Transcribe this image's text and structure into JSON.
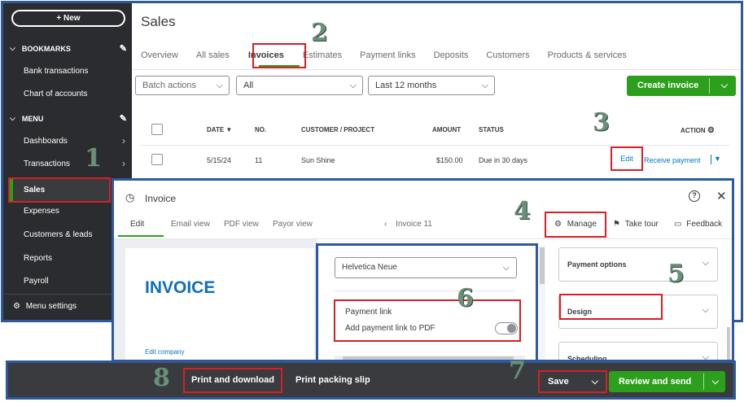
{
  "sidebar": {
    "new_label": "+ New",
    "bookmarks_label": "BOOKMARKS",
    "bookmarks": [
      "Bank transactions",
      "Chart of accounts"
    ],
    "menu_label": "MENU",
    "items": [
      {
        "label": "Dashboards",
        "arrow": true
      },
      {
        "label": "Transactions",
        "arrow": true
      },
      {
        "label": "Sales",
        "arrow": false
      },
      {
        "label": "Expenses",
        "arrow": false
      },
      {
        "label": "Customers & leads",
        "arrow": false
      },
      {
        "label": "Reports",
        "arrow": false
      },
      {
        "label": "Payroll",
        "arrow": false
      }
    ],
    "menu_settings": "Menu settings"
  },
  "header": {
    "title": "Sales",
    "tabs": [
      "Overview",
      "All sales",
      "Invoices",
      "Estimates",
      "Payment links",
      "Deposits",
      "Customers",
      "Products & services"
    ]
  },
  "filters": {
    "batch_actions": "Batch actions",
    "status": "All",
    "date_range": "Last 12 months",
    "create_invoice": "Create invoice"
  },
  "table": {
    "columns": {
      "date": "DATE ▼",
      "no": "NO.",
      "customer": "CUSTOMER / PROJECT",
      "amount": "AMOUNT",
      "status": "STATUS",
      "action": "ACTION"
    },
    "row": {
      "date": "5/15/24",
      "no": "11",
      "customer": "Sun Shine",
      "amount": "$150.00",
      "status": "Due in 30 days",
      "edit": "Edit",
      "receive": "Receive payment"
    }
  },
  "modal": {
    "title": "Invoice",
    "tabs": [
      "Edit",
      "Email view",
      "PDF view",
      "Payor view"
    ],
    "nav_label": "Invoice 11",
    "manage": "Manage",
    "take_tour": "Take tour",
    "feedback": "Feedback",
    "invoice_heading": "INVOICE",
    "edit_company": "Edit company",
    "font_value": "Helvetica Neue",
    "payment_link_title": "Payment link",
    "payment_link_text": "Add payment link to PDF",
    "payment_link_on": false,
    "right_panels": [
      "Payment options",
      "Design",
      "Scheduling"
    ]
  },
  "footer": {
    "print_download": "Print and download",
    "print_slip": "Print packing slip",
    "save": "Save",
    "review_send": "Review and send"
  },
  "annotations": [
    "1",
    "2",
    "3",
    "4",
    "5",
    "6",
    "7",
    "8"
  ],
  "colors": {
    "accent": "#2ca01c",
    "link": "#0077c5",
    "highlight": "#d61f26",
    "frame": "#2e5a9c",
    "sidebar": "#2b2c2f"
  }
}
